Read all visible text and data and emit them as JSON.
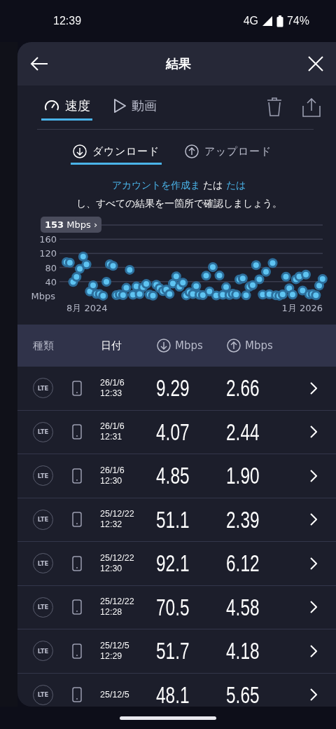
{
  "status_bar": {
    "time": "12:39",
    "network": "4G",
    "battery": "74%"
  },
  "header": {
    "title": "結果"
  },
  "tabs": [
    {
      "label": "速度",
      "kind": "gauge",
      "selected": true
    },
    {
      "label": "動画",
      "kind": "play",
      "selected": false
    }
  ],
  "subtabs": [
    {
      "label": "ダウンロード",
      "kind": "down",
      "selected": true
    },
    {
      "label": "アップロード",
      "kind": "up",
      "selected": false
    }
  ],
  "promo": {
    "link_1": "アカウントを作成ま",
    "middle": "たは",
    "link_2": "たは",
    "rest": "し、すべての結果を一箇所で確認しましょう。"
  },
  "chart": {
    "tooltip": "**153** Mbps ›",
    "y_ticks": [
      "160",
      "120",
      "80",
      "40"
    ],
    "y_unit": "Mbps",
    "x_labels": [
      "8月 2024",
      "1月 2026"
    ]
  },
  "table": {
    "columns": [
      {
        "label": "種類"
      },
      {
        "label": "日付"
      },
      {
        "label": "Mbps",
        "kind": "down"
      },
      {
        "label": "Mbps",
        "kind": "up"
      }
    ],
    "rows": [
      {
        "network": "LTE",
        "date": "26/1/6",
        "time": "12:33",
        "download": "9.29",
        "upload": "2.66"
      },
      {
        "network": "LTE",
        "date": "26/1/6",
        "time": "12:31",
        "download": "4.07",
        "upload": "2.44"
      },
      {
        "network": "LTE",
        "date": "26/1/6",
        "time": "12:30",
        "download": "4.85",
        "upload": "1.90"
      },
      {
        "network": "LTE",
        "date": "25/12/22",
        "time": "12:32",
        "download": "51.1",
        "upload": "2.39"
      },
      {
        "network": "LTE",
        "date": "25/12/22",
        "time": "12:30",
        "download": "92.1",
        "upload": "6.12"
      },
      {
        "network": "LTE",
        "date": "25/12/22",
        "time": "12:28",
        "download": "70.5",
        "upload": "4.58"
      },
      {
        "network": "LTE",
        "date": "25/12/5",
        "time": "12:29",
        "download": "51.7",
        "upload": "4.18"
      },
      {
        "network": "LTE",
        "date": "25/12/5",
        "download": "48.1",
        "upload": "5.65"
      }
    ]
  }
}
